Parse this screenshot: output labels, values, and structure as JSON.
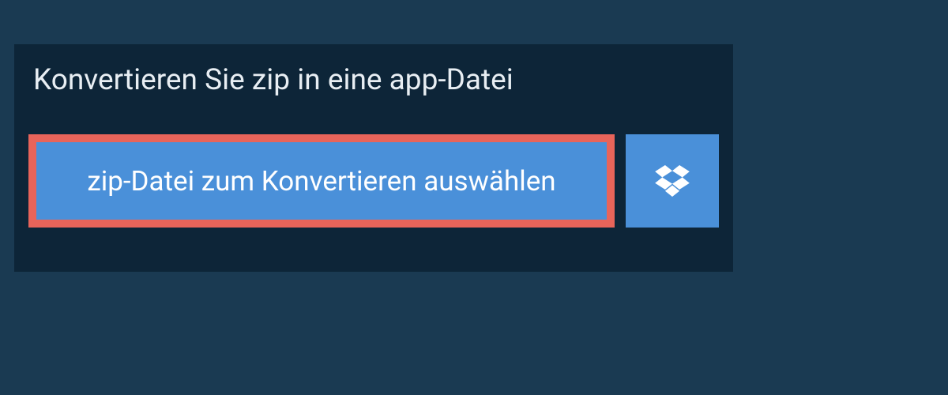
{
  "title": "Konvertieren Sie zip in eine app-Datei",
  "selectFileButton": {
    "label": "zip-Datei zum Konvertieren auswählen"
  },
  "icons": {
    "dropbox": "dropbox-icon"
  },
  "colors": {
    "background": "#1a3a52",
    "panel": "#0d2538",
    "button": "#4a90d9",
    "buttonBorder": "#e8645a",
    "titleText": "#e8eef3",
    "buttonText": "#ffffff"
  }
}
